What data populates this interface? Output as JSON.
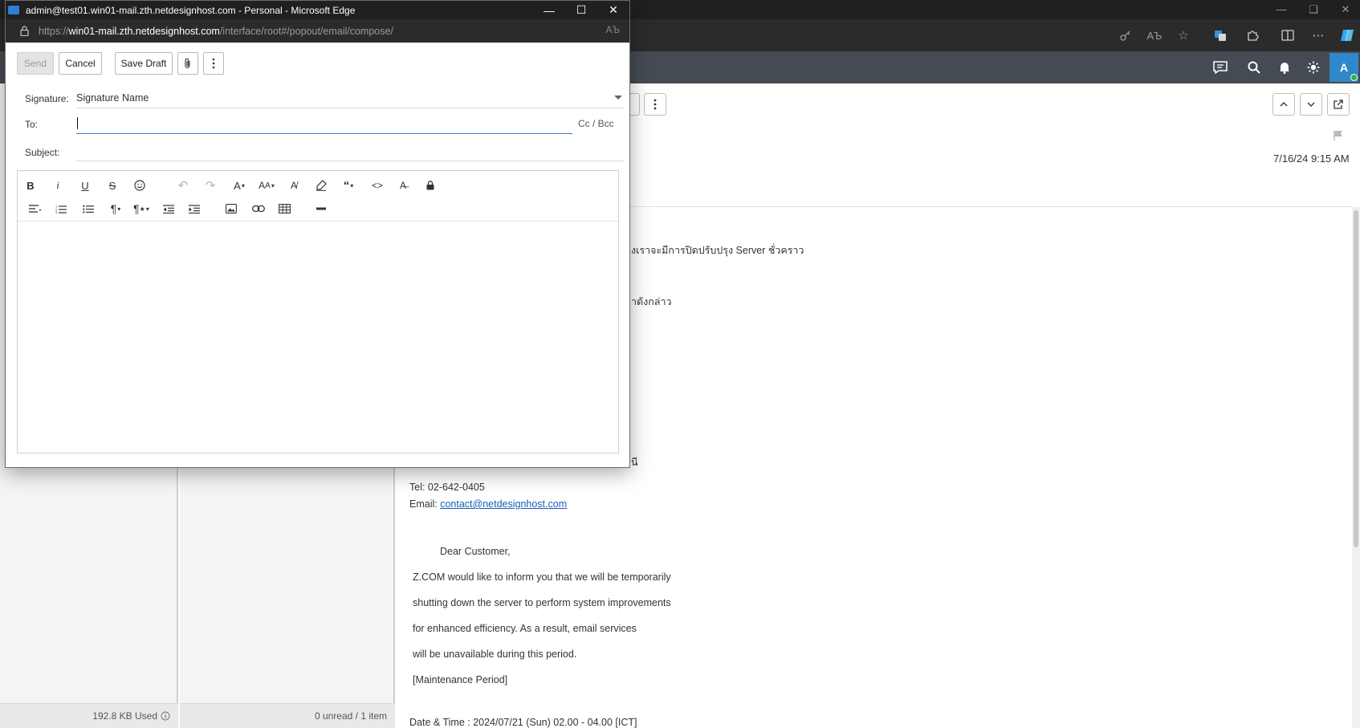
{
  "popup": {
    "title": "admin@test01.win01-mail.zth.netdesignhost.com - Personal - Microsoft Edge",
    "url_prefix": "https://",
    "url_host": "win01-mail.zth.netdesignhost.com",
    "url_path": "/interface/root#/popout/email/compose/",
    "toolbar": {
      "send_label": "Send",
      "cancel_label": "Cancel",
      "save_draft_label": "Save Draft"
    },
    "form": {
      "signature_label": "Signature:",
      "signature_value": "Signature Name",
      "to_label": "To:",
      "to_value": "",
      "cc_bcc_label": "Cc / Bcc",
      "subject_label": "Subject:",
      "subject_value": ""
    },
    "editor_icons": [
      "bold-icon",
      "italic-icon",
      "underline-icon",
      "strikethrough-icon",
      "emoji-icon",
      "undo-icon",
      "redo-icon",
      "font-icon",
      "font-size-icon",
      "text-color-icon",
      "highlight-icon",
      "quote-icon",
      "code-icon",
      "clear-format-icon",
      "lock-icon",
      "align-icon",
      "ordered-list-icon",
      "unordered-list-icon",
      "paragraph-icon",
      "paragraph-style-icon",
      "outdent-icon",
      "indent-icon",
      "image-icon",
      "link-icon",
      "table-icon",
      "horizontal-rule-icon"
    ]
  },
  "reader": {
    "date": "7/16/24 9:15 AM",
    "body_lines": {
      "thai_1": "งเราจะมีการปิดปรับปรุง Server ชั่วคราว",
      "thai_2": "าดังกล่าว",
      "thai_3": "นี",
      "tel": "Tel: 02-642-0405",
      "email_label": "Email: ",
      "email_link": "contact@netdesignhost.com",
      "greeting": "Dear Customer,",
      "p1": "Z.COM would like to inform you that we will be temporarily",
      "p2": "shutting down the server to perform system improvements",
      "p3": "for enhanced efficiency. As a result, email services",
      "p4": "will be unavailable during this period.",
      "p5": "[Maintenance Period]",
      "p6": "Date & Time : 2024/07/21 (Sun) 02.00 - 04.00 [ICT]"
    }
  },
  "status": {
    "storage_used": "192.8 KB Used",
    "unread_summary": "0 unread / 1 item"
  },
  "appbar": {
    "avatar_letter": "A"
  },
  "colors": {
    "accent": "#2f88c9",
    "link": "#1a5fb4",
    "chrome_dark": "#202020",
    "appbar": "#444b52"
  }
}
